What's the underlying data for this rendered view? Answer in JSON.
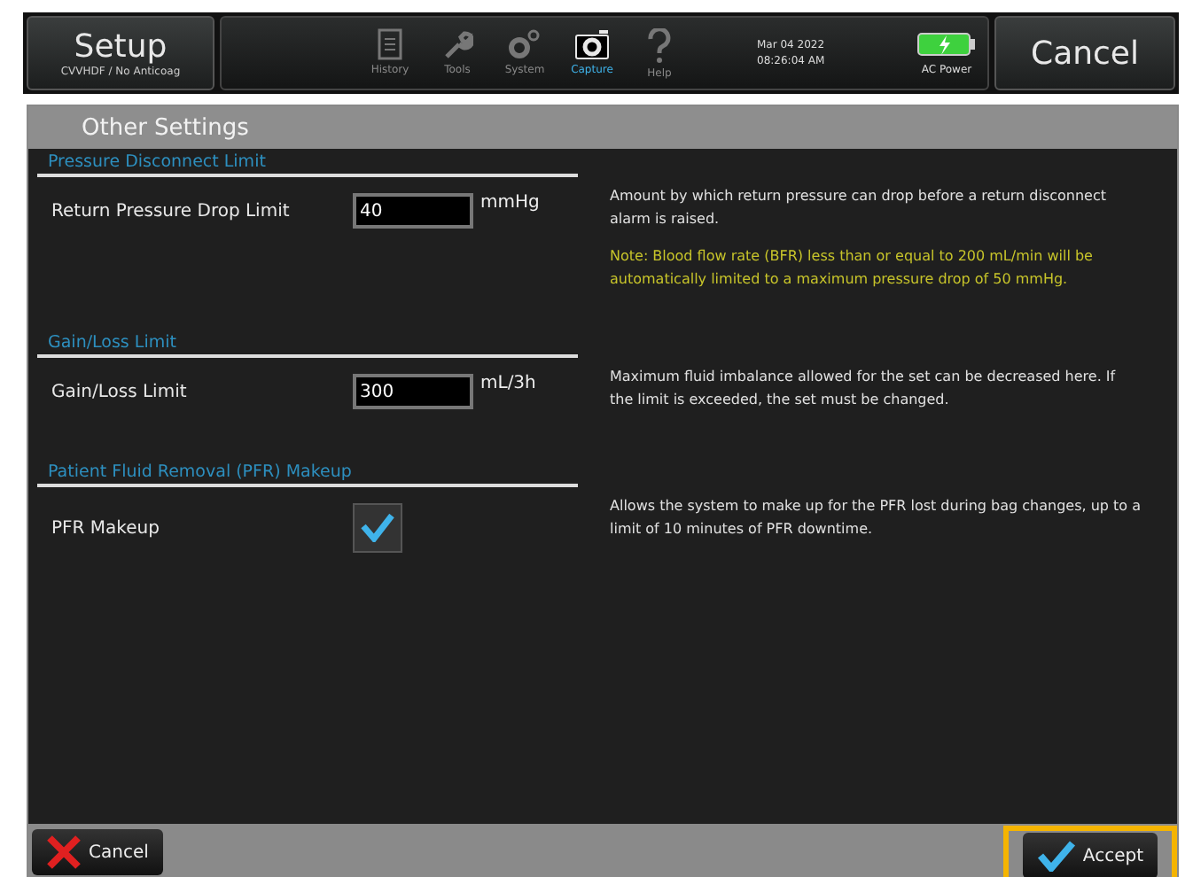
{
  "header": {
    "title": "Setup",
    "subtitle": "CVVHDF / No Anticoag",
    "cancel": "Cancel",
    "date": "Mar 04 2022",
    "time": "08:26:04 AM",
    "power": "AC Power"
  },
  "nav": [
    {
      "kind": "history",
      "label": "History",
      "selected": false
    },
    {
      "kind": "tools",
      "label": "Tools",
      "selected": false
    },
    {
      "kind": "system",
      "label": "System",
      "selected": false
    },
    {
      "kind": "capture",
      "label": "Capture",
      "selected": true
    },
    {
      "kind": "help",
      "label": "Help",
      "selected": false
    }
  ],
  "panel_title": "Other Settings",
  "sections": [
    {
      "heading": "Pressure Disconnect Limit",
      "label": "Return Pressure Drop Limit",
      "kind": "input",
      "value": "40",
      "unit": "mmHg",
      "descriptions": [
        {
          "kind": "info",
          "text": "Amount by which return pressure can drop before a return disconnect alarm is raised."
        },
        {
          "kind": "note",
          "text": "Note: Blood flow rate (BFR) less than or equal to 200 mL/min will be automatically limited to a maximum pressure drop of 50 mmHg."
        }
      ]
    },
    {
      "heading": "Gain/Loss Limit",
      "label": "Gain/Loss Limit",
      "kind": "input",
      "value": "300",
      "unit": "mL/3h",
      "descriptions": [
        {
          "kind": "info",
          "text": "Maximum fluid imbalance allowed for the set can be decreased here. If the limit is exceeded, the set must be changed."
        }
      ]
    },
    {
      "heading": "Patient Fluid Removal (PFR) Makeup",
      "label": "PFR Makeup",
      "kind": "checkbox",
      "checked": true,
      "descriptions": [
        {
          "kind": "info",
          "text": "Allows the system to make up for the PFR lost during bag changes, up to a limit of 10 minutes of PFR downtime."
        }
      ]
    }
  ],
  "footer": {
    "cancel": "Cancel",
    "accept": "Accept",
    "accept_highlighted": true
  }
}
